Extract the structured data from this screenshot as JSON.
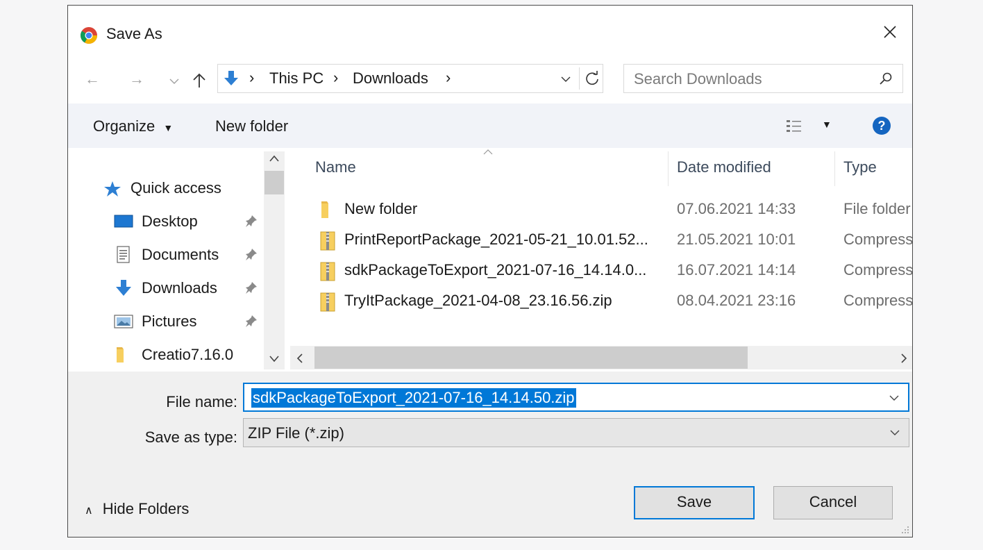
{
  "window": {
    "title": "Save As",
    "icon": "chrome-icon"
  },
  "address": {
    "segments": [
      "This PC",
      "Downloads"
    ],
    "search_placeholder": "Search Downloads"
  },
  "toolbar": {
    "organize_label": "Organize",
    "new_folder_label": "New folder"
  },
  "nav": {
    "quick_access": "Quick access",
    "items": [
      {
        "label": "Desktop",
        "icon": "desktop-icon",
        "pinned": true
      },
      {
        "label": "Documents",
        "icon": "documents-icon",
        "pinned": true
      },
      {
        "label": "Downloads",
        "icon": "downloads-icon",
        "pinned": true
      },
      {
        "label": "Pictures",
        "icon": "pictures-icon",
        "pinned": true
      },
      {
        "label": "Creatio7.16.0",
        "icon": "folder-icon",
        "pinned": false
      }
    ]
  },
  "list": {
    "columns": {
      "name": "Name",
      "date": "Date modified",
      "type": "Type"
    },
    "rows": [
      {
        "name": "New folder",
        "date": "07.06.2021 14:33",
        "type": "File folder",
        "icon": "folder-icon"
      },
      {
        "name": "PrintReportPackage_2021-05-21_10.01.52...",
        "date": "21.05.2021 10:01",
        "type": "Compressed",
        "icon": "zip-folder-icon"
      },
      {
        "name": "sdkPackageToExport_2021-07-16_14.14.0...",
        "date": "16.07.2021 14:14",
        "type": "Compressed",
        "icon": "zip-folder-icon"
      },
      {
        "name": "TryItPackage_2021-04-08_23.16.56.zip",
        "date": "08.04.2021 23:16",
        "type": "Compressed",
        "icon": "zip-folder-icon"
      }
    ]
  },
  "form": {
    "file_name_label": "File name:",
    "file_name_value": "sdkPackageToExport_2021-07-16_14.14.50.zip",
    "save_type_label": "Save as type:",
    "save_type_value": "ZIP File (*.zip)"
  },
  "buttons": {
    "save": "Save",
    "cancel": "Cancel",
    "hide_folders": "Hide Folders"
  },
  "colors": {
    "accent": "#0078d7",
    "toolbar_bg": "#f1f3f8",
    "bottom_bg": "#f0f0f0"
  }
}
